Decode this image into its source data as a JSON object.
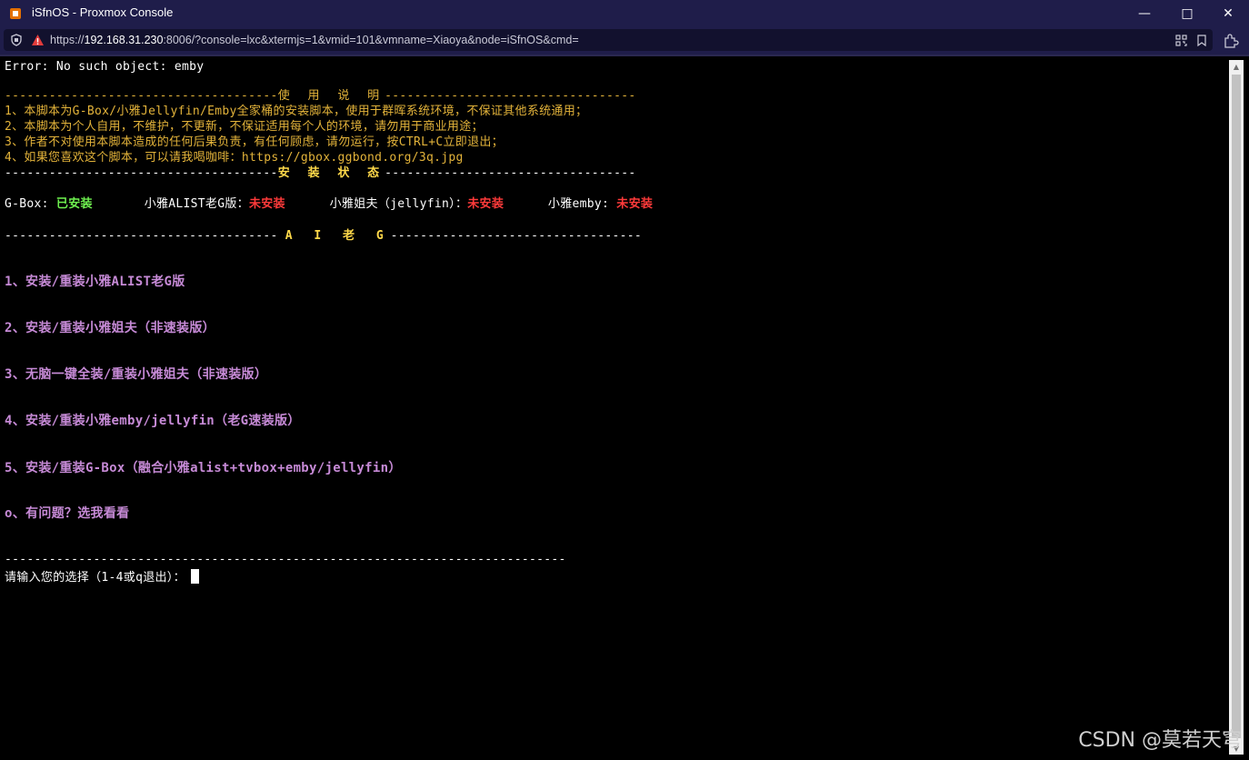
{
  "window": {
    "title": "iSfnOS - Proxmox Console",
    "minimize": "—",
    "maximize": "□",
    "close": "✕"
  },
  "address": {
    "url_prefix": "https://",
    "url_host": "192.168.31.230",
    "url_rest": ":8006/?console=lxc&xtermjs=1&vmid=101&vmname=Xiaoya&node=iSfnOS&cmd="
  },
  "terminal": {
    "error": "Error: No such object: emby",
    "usage_header_left": "-------------------------------------",
    "usage_header_title": "使 用 说 明",
    "usage_header_right": "----------------------------------",
    "usage": [
      "1、本脚本为G-Box/小雅Jellyfin/Emby全家桶的安装脚本，使用于群晖系统环境，不保证其他系统通用；",
      "2、本脚本为个人自用，不维护，不更新，不保证适用每个人的环境，请勿用于商业用途；",
      "3、作者不对使用本脚本造成的任何后果负责，有任何顾虑，请勿运行，按CTRL+C立即退出；",
      "4、如果您喜欢这个脚本，可以请我喝咖啡：https://gbox.ggbond.org/3q.jpg"
    ],
    "status_header_title": "安 装 状 态",
    "status": {
      "gbox_label": "G-Box: ",
      "gbox_value": "已安装",
      "alist_label": "小雅ALIST老G版：",
      "alist_value": "未安装",
      "jellyfin_label": "小雅姐夫（jellyfin）：",
      "jellyfin_value": "未安装",
      "emby_label": "小雅emby: ",
      "emby_value": "未安装"
    },
    "menu_header_title": "A I 老 G",
    "menu": [
      "1、安装/重装小雅ALIST老G版",
      "2、安装/重装小雅姐夫（非速装版）",
      "3、无脑一键全装/重装小雅姐夫（非速装版）",
      "4、安装/重装小雅emby/jellyfin（老G速装版）",
      "5、安装/重装G-Box（融合小雅alist+tvbox+emby/jellyfin）",
      "o、有问题？选我看看"
    ],
    "footer_rule": "----------------------------------------------------------------------------",
    "prompt": "请输入您的选择（1-4或q退出）："
  },
  "watermark": "CSDN @莫若天穹",
  "colors": {
    "titlebar": "#1f1d4a",
    "status_installed": "#6ef04f",
    "status_missing": "#ff3a3a",
    "usage_text": "#e3b33a",
    "menu_text": "#c68ad6"
  }
}
